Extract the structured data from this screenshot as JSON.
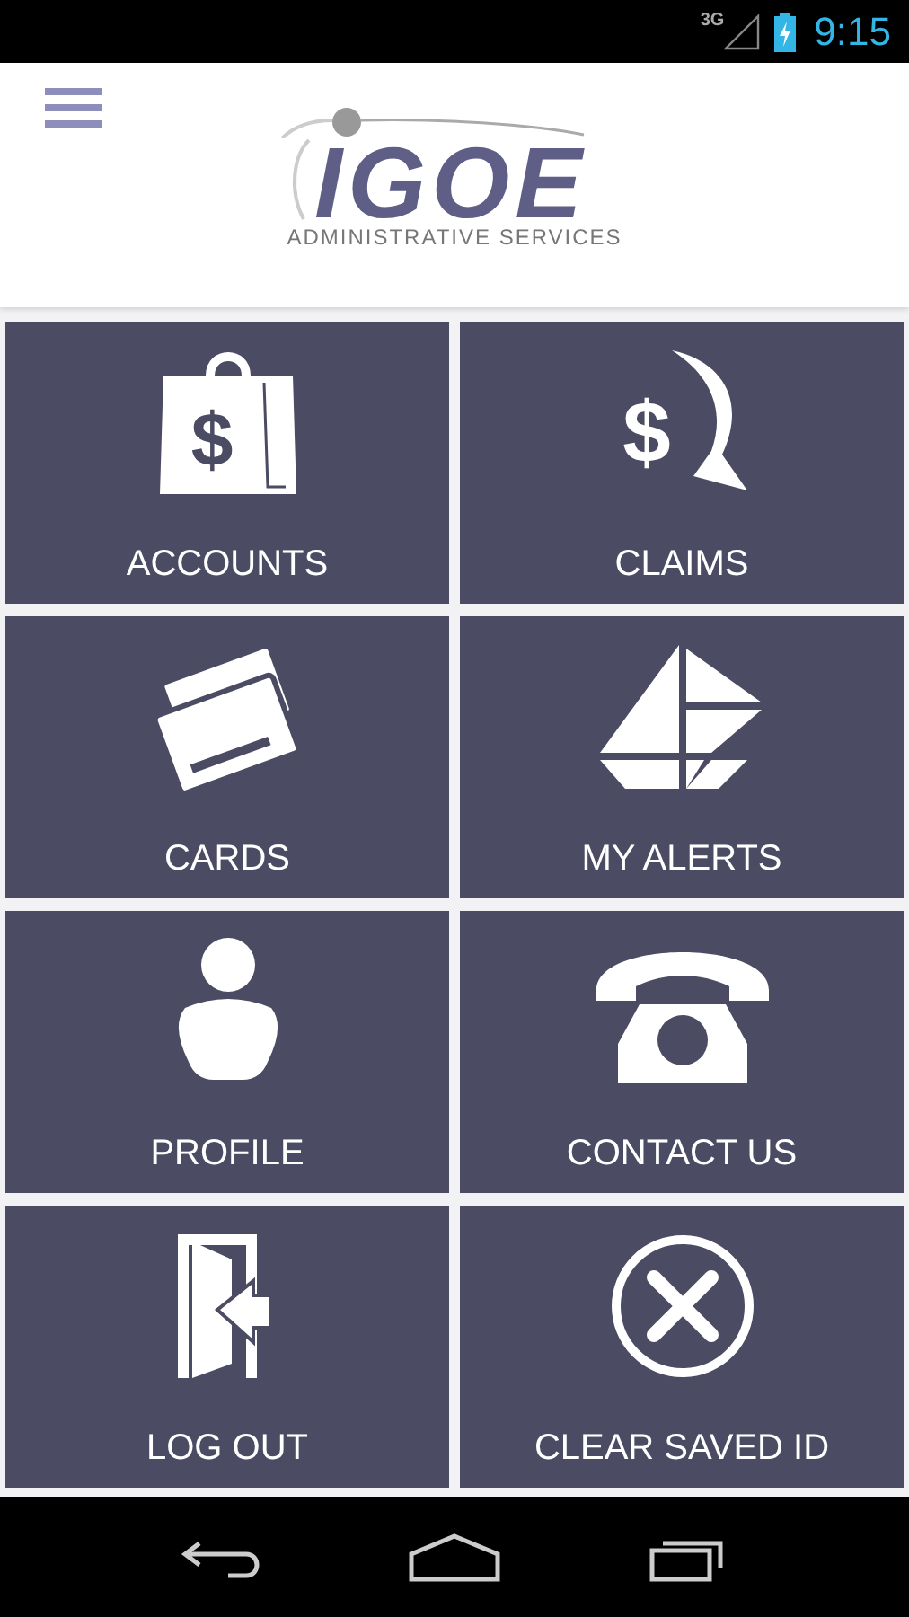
{
  "status_bar": {
    "network": "3G",
    "time": "9:15"
  },
  "logo": {
    "name": "IGOE",
    "tagline": "ADMINISTRATIVE SERVICES"
  },
  "tiles": [
    {
      "kind": "accounts",
      "label": "ACCOUNTS",
      "glyph": "$"
    },
    {
      "kind": "claims",
      "label": "CLAIMS",
      "glyph": "$"
    },
    {
      "kind": "cards",
      "label": "CARDS"
    },
    {
      "kind": "alerts",
      "label": "MY ALERTS"
    },
    {
      "kind": "profile",
      "label": "PROFILE"
    },
    {
      "kind": "contact",
      "label": "CONTACT US"
    },
    {
      "kind": "logout",
      "label": "LOG OUT"
    },
    {
      "kind": "clear",
      "label": "CLEAR SAVED ID"
    }
  ]
}
